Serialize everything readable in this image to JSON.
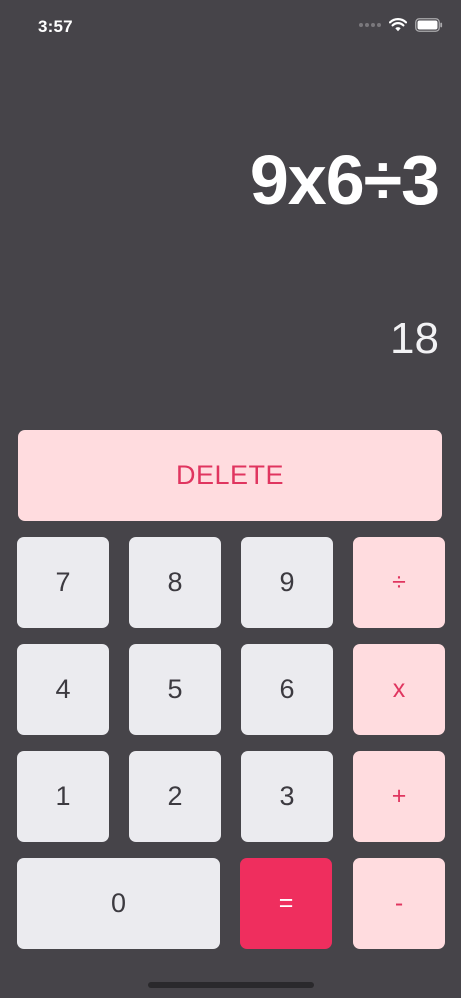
{
  "status_bar": {
    "time": "3:57",
    "icons": [
      "cellular-signal-icon",
      "wifi-icon",
      "battery-icon"
    ]
  },
  "display": {
    "expression": "9x6÷3",
    "result": "18"
  },
  "keypad": {
    "delete_label": "DELETE",
    "digits": {
      "seven": "7",
      "eight": "8",
      "nine": "9",
      "four": "4",
      "five": "5",
      "six": "6",
      "one": "1",
      "two": "2",
      "three": "3",
      "zero": "0"
    },
    "operators": {
      "divide": "÷",
      "multiply": "x",
      "add": "+",
      "subtract": "-",
      "equals": "="
    }
  },
  "colors": {
    "background": "#464449",
    "number_key": "#ebebef",
    "operator_key": "#ffdcdf",
    "operator_text": "#e0355f",
    "equals_key": "#ef2e5e"
  }
}
